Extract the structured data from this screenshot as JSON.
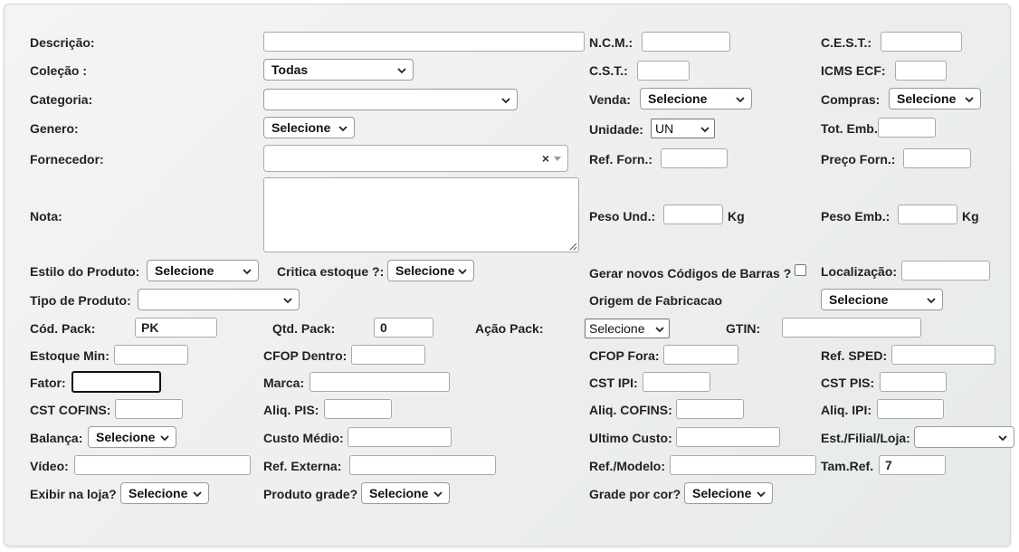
{
  "labels": {
    "descricao": "Descrição:",
    "ncm": "N.C.M.:",
    "cest": "C.E.S.T.:",
    "colecao": "Coleção :",
    "cst": "C.S.T.:",
    "icms_ecf": "ICMS ECF:",
    "categoria": "Categoria:",
    "venda": "Venda:",
    "compras": "Compras:",
    "genero": "Genero:",
    "unidade": "Unidade:",
    "tot_emb": "Tot. Emb.:",
    "fornecedor": "Fornecedor:",
    "ref_forn": "Ref. Forn.:",
    "preco_forn": "Preço Forn.:",
    "nota": "Nota:",
    "peso_und": "Peso Und.:",
    "peso_und_unit": "Kg",
    "peso_emb": "Peso Emb.:",
    "peso_emb_unit": "Kg",
    "estilo_produto": "Estilo do Produto:",
    "critica_estoque": "Critica estoque ?:",
    "gerar_codigos": "Gerar novos Códigos de Barras ?",
    "localizacao": "Localização:",
    "tipo_produto": "Tipo de Produto:",
    "origem_fabricacao": "Origem de Fabricacao",
    "cod_pack": "Cód. Pack:",
    "qtd_pack": "Qtd. Pack:",
    "acao_pack": "Ação Pack:",
    "gtin": "GTIN:",
    "estoque_min": "Estoque Min:",
    "cfop_dentro": "CFOP Dentro:",
    "cfop_fora": "CFOP Fora:",
    "ref_sped": "Ref. SPED:",
    "fator": "Fator:",
    "marca": "Marca:",
    "cst_ipi": "CST IPI:",
    "cst_pis": "CST PIS:",
    "cst_cofins": "CST COFINS:",
    "aliq_pis": "Aliq. PIS:",
    "aliq_cofins": "Aliq. COFINS:",
    "aliq_ipi": "Aliq. IPI:",
    "balanca": "Balança:",
    "custo_medio": "Custo Médio:",
    "ultimo_custo": "Ultimo Custo:",
    "est_filial_loja": "Est./Filial/Loja:",
    "video": "Vídeo:",
    "ref_externa": "Ref. Externa:",
    "ref_modelo": "Ref./Modelo:",
    "tam_ref": "Tam.Ref.",
    "exibir_loja": "Exibir na loja?",
    "produto_grade": "Produto grade?",
    "grade_cor": "Grade por cor?"
  },
  "values": {
    "colecao": "Todas",
    "venda": "Selecione",
    "compras": "Selecione",
    "genero": "Selecione",
    "unidade": "UN",
    "fornecedor_clear": "×",
    "estilo_produto": "Selecione",
    "critica_estoque": "Selecione",
    "origem_fabricacao": "Selecione",
    "cod_pack": "PK",
    "qtd_pack": "0",
    "acao_pack": "Selecione",
    "balanca": "Selecione",
    "tam_ref": "7",
    "exibir_loja": "Selecione",
    "produto_grade": "Selecione",
    "grade_cor": "Selecione"
  },
  "icons": {
    "select_arrow": "chevron-down-icon",
    "textarea_resize": "resize-grip-icon",
    "select2_clear": "clear-x-icon",
    "select2_arrow": "caret-down-icon"
  },
  "colors": {
    "panel_bg": "#eef0ee",
    "label_text": "#222222",
    "input_border": "#a9a9a9",
    "focused_border": "#111111"
  }
}
